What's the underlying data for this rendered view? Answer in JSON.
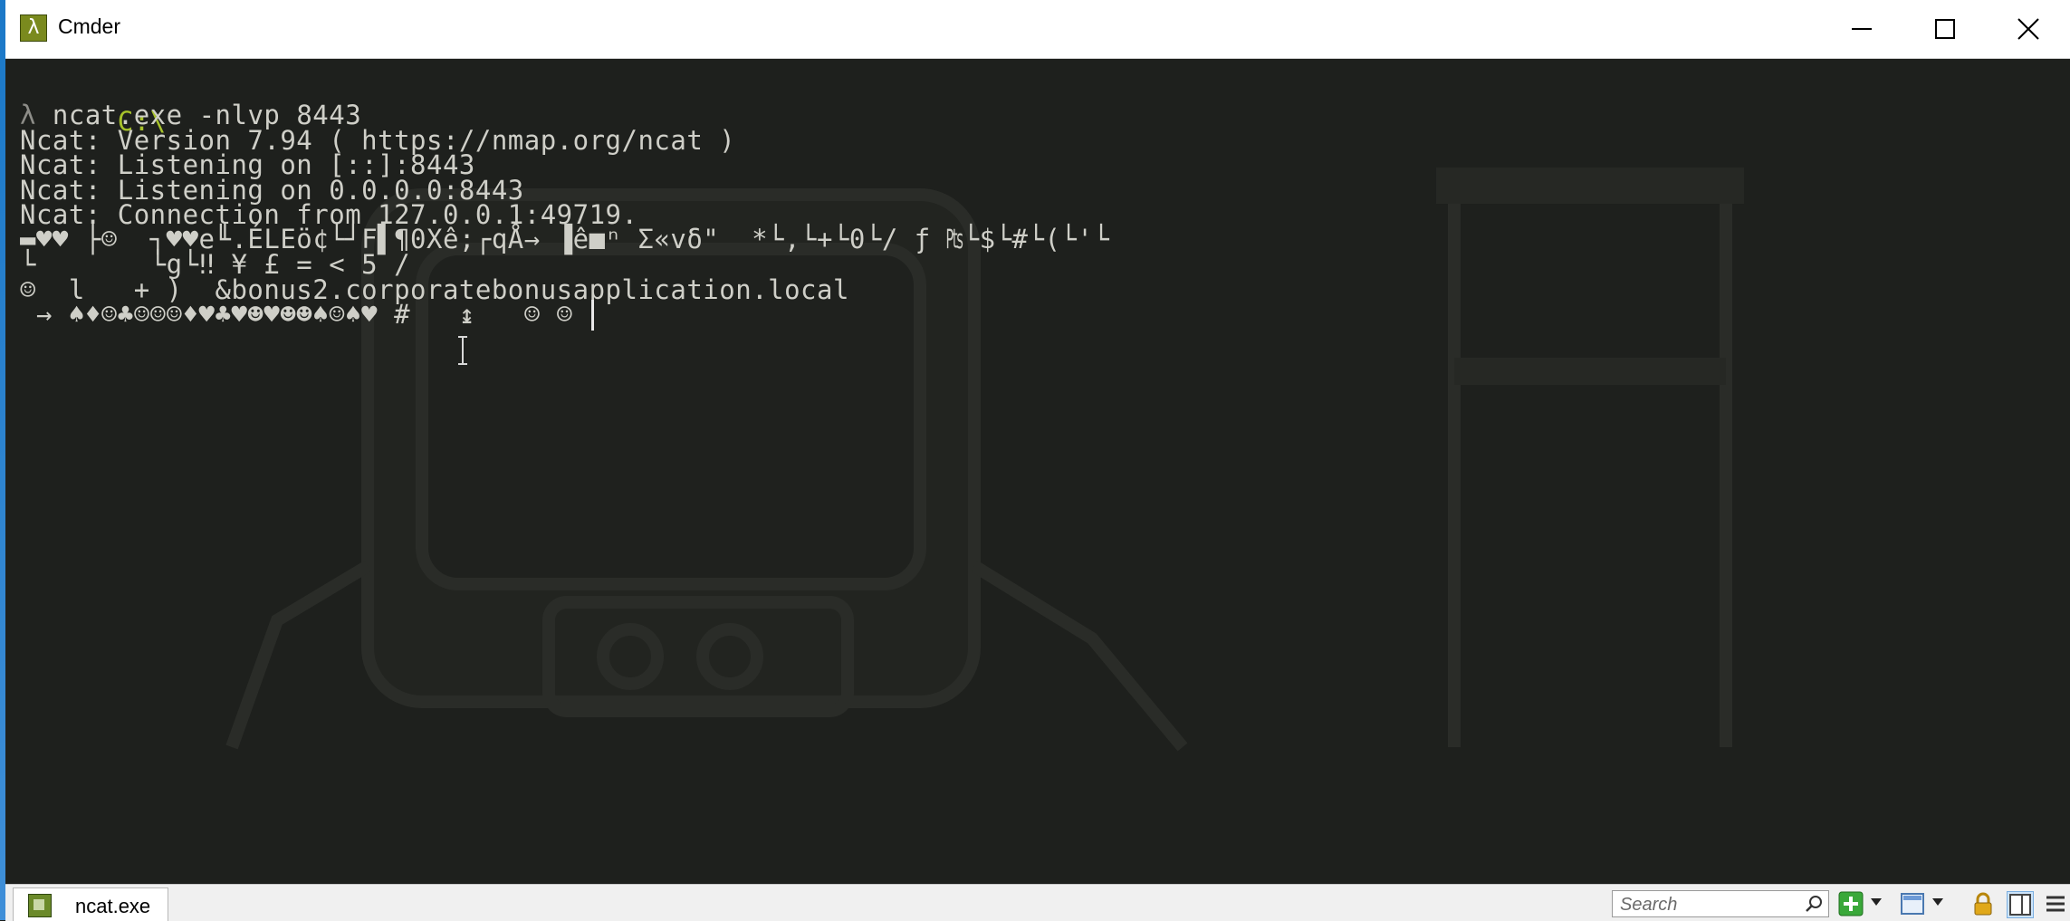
{
  "window": {
    "title": "Cmder",
    "icon": "lambda-icon",
    "app_icon_glyph": "λ"
  },
  "terminal": {
    "prompt_path": "C:\\",
    "prompt_symbol": "λ",
    "command": " ncat.exe -nlvp 8443",
    "lines": [
      "Ncat: Version 7.94 ( https://nmap.org/ncat )",
      "Ncat: Listening on [::]:8443",
      "Ncat: Listening on 0.0.0.0:8443",
      "Ncat: Connection from 127.0.0.1:49719.",
      "▬♥♥ ├☺  ┐♥♥e╙.ÉLEö¢└┘F▌¶0Xê;┌qÅ→ ▐ê■ⁿ Σ«vδ\"  *└,└+└0└/ ƒ ₧└$└#└(└'└",
      "└       └g└‼ ¥ £ = < 5 /",
      "☺  l   + )  &bonus2.corporatebonusapplication.local",
      " → ♠♦☺♣☺☺☺♦♥♣♥☻♥☻☻♠☺♠♥ #   ↨   ☺ ☺"
    ],
    "colors": {
      "prompt_path": "#a7c22a",
      "text": "#cfcfc8",
      "background": "#1e201d"
    }
  },
  "statusbar": {
    "tab_label": "ncat.exe",
    "tab_icon": "console-icon",
    "search_placeholder": "Search",
    "tools": [
      "new-console-icon",
      "dropdown-icon",
      "layout-icon",
      "dropdown-icon",
      "lock-icon",
      "split-view-icon",
      "menu-icon"
    ]
  }
}
